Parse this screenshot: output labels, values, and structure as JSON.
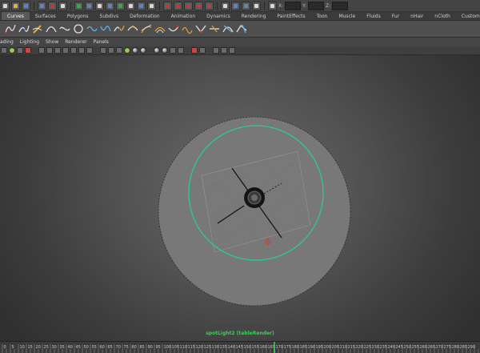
{
  "shelf_tabs": [
    {
      "label": "Curves",
      "active": true
    },
    {
      "label": "Surfaces"
    },
    {
      "label": "Polygons"
    },
    {
      "label": "Subdivs"
    },
    {
      "label": "Deformation"
    },
    {
      "label": "Animation"
    },
    {
      "label": "Dynamics"
    },
    {
      "label": "Rendering"
    },
    {
      "label": "PaintEffects"
    },
    {
      "label": "Toon"
    },
    {
      "label": "Muscle"
    },
    {
      "label": "Fluids"
    },
    {
      "label": "Fur"
    },
    {
      "label": "nHair"
    },
    {
      "label": "nCloth"
    },
    {
      "label": "Custom"
    }
  ],
  "panel_menu": [
    "ading",
    "Lighting",
    "Show",
    "Renderer",
    "Panels"
  ],
  "status_line": {
    "axis_x": "X:",
    "axis_y": "Y:",
    "axis_z": "Z:"
  },
  "viewport": {
    "object_label": "spotLight2 (tableRender)",
    "colors": {
      "selection_ring": "#2ec6a0",
      "label": "#2fd64a",
      "floor": "#7a7a7a"
    }
  },
  "time_slider": {
    "ticks": [
      "0",
      "5",
      "10",
      "15",
      "20",
      "25",
      "30",
      "35",
      "40",
      "45",
      "50",
      "55",
      "60",
      "65",
      "70",
      "75",
      "80",
      "85",
      "90",
      "95",
      "100",
      "105",
      "110",
      "115",
      "120",
      "125",
      "130",
      "135",
      "140",
      "145",
      "150",
      "155",
      "160",
      "165",
      "170",
      "175",
      "180",
      "185",
      "190",
      "195",
      "200",
      "205",
      "210",
      "215",
      "220",
      "225",
      "230",
      "235",
      "240",
      "245",
      "250",
      "255",
      "260",
      "265",
      "270",
      "275",
      "280",
      "285",
      "290"
    ],
    "current_frame": "170",
    "current_color": "#2fd64a"
  }
}
